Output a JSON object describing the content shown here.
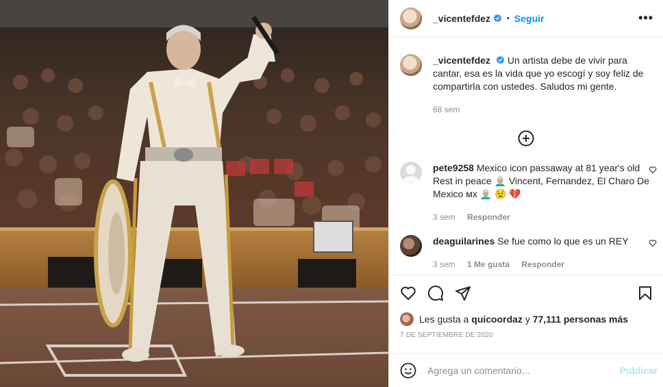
{
  "post_photo": {
    "alt_icon": "concert-photo-image"
  },
  "header": {
    "username": "_vicentefdez",
    "separator": "•",
    "follow_label": "Seguir",
    "more_label": "•••"
  },
  "caption": {
    "username": "_vicentefdez",
    "text": "Un artista debe de vivir para cantar, esa es la vida que yo escogí y soy feliz de compartirla con ustedes. Saludos mi gente.",
    "time": "68 sem"
  },
  "comments": [
    {
      "username": "pete9258",
      "text": "Mexico icon passaway at 81 year's old Rest in peace 👨🏼‍🦳 Vincent, Fernandez, El Charo De Mexico ᴍx 👨🏼‍🦳 😟 💔",
      "time": "3 sem",
      "reply_label": "Responder"
    },
    {
      "username": "deaguilarines",
      "text": "Se fue como lo que es un REY",
      "time": "3 sem",
      "likes_label": "1 Me gusta",
      "reply_label": "Responder"
    }
  ],
  "likes": {
    "prefix": "Les gusta a",
    "user": "quicoordaz",
    "middle": "y",
    "count": "77,111 personas más"
  },
  "date": "7 DE SEPTIEMBRE DE 2020",
  "add_comment": {
    "placeholder": "Agrega un comentario...",
    "publish_label": "Publicar"
  },
  "colors": {
    "accent": "#0095f6",
    "muted": "#8e8e8e",
    "publish_disabled": "#b2dffc"
  }
}
